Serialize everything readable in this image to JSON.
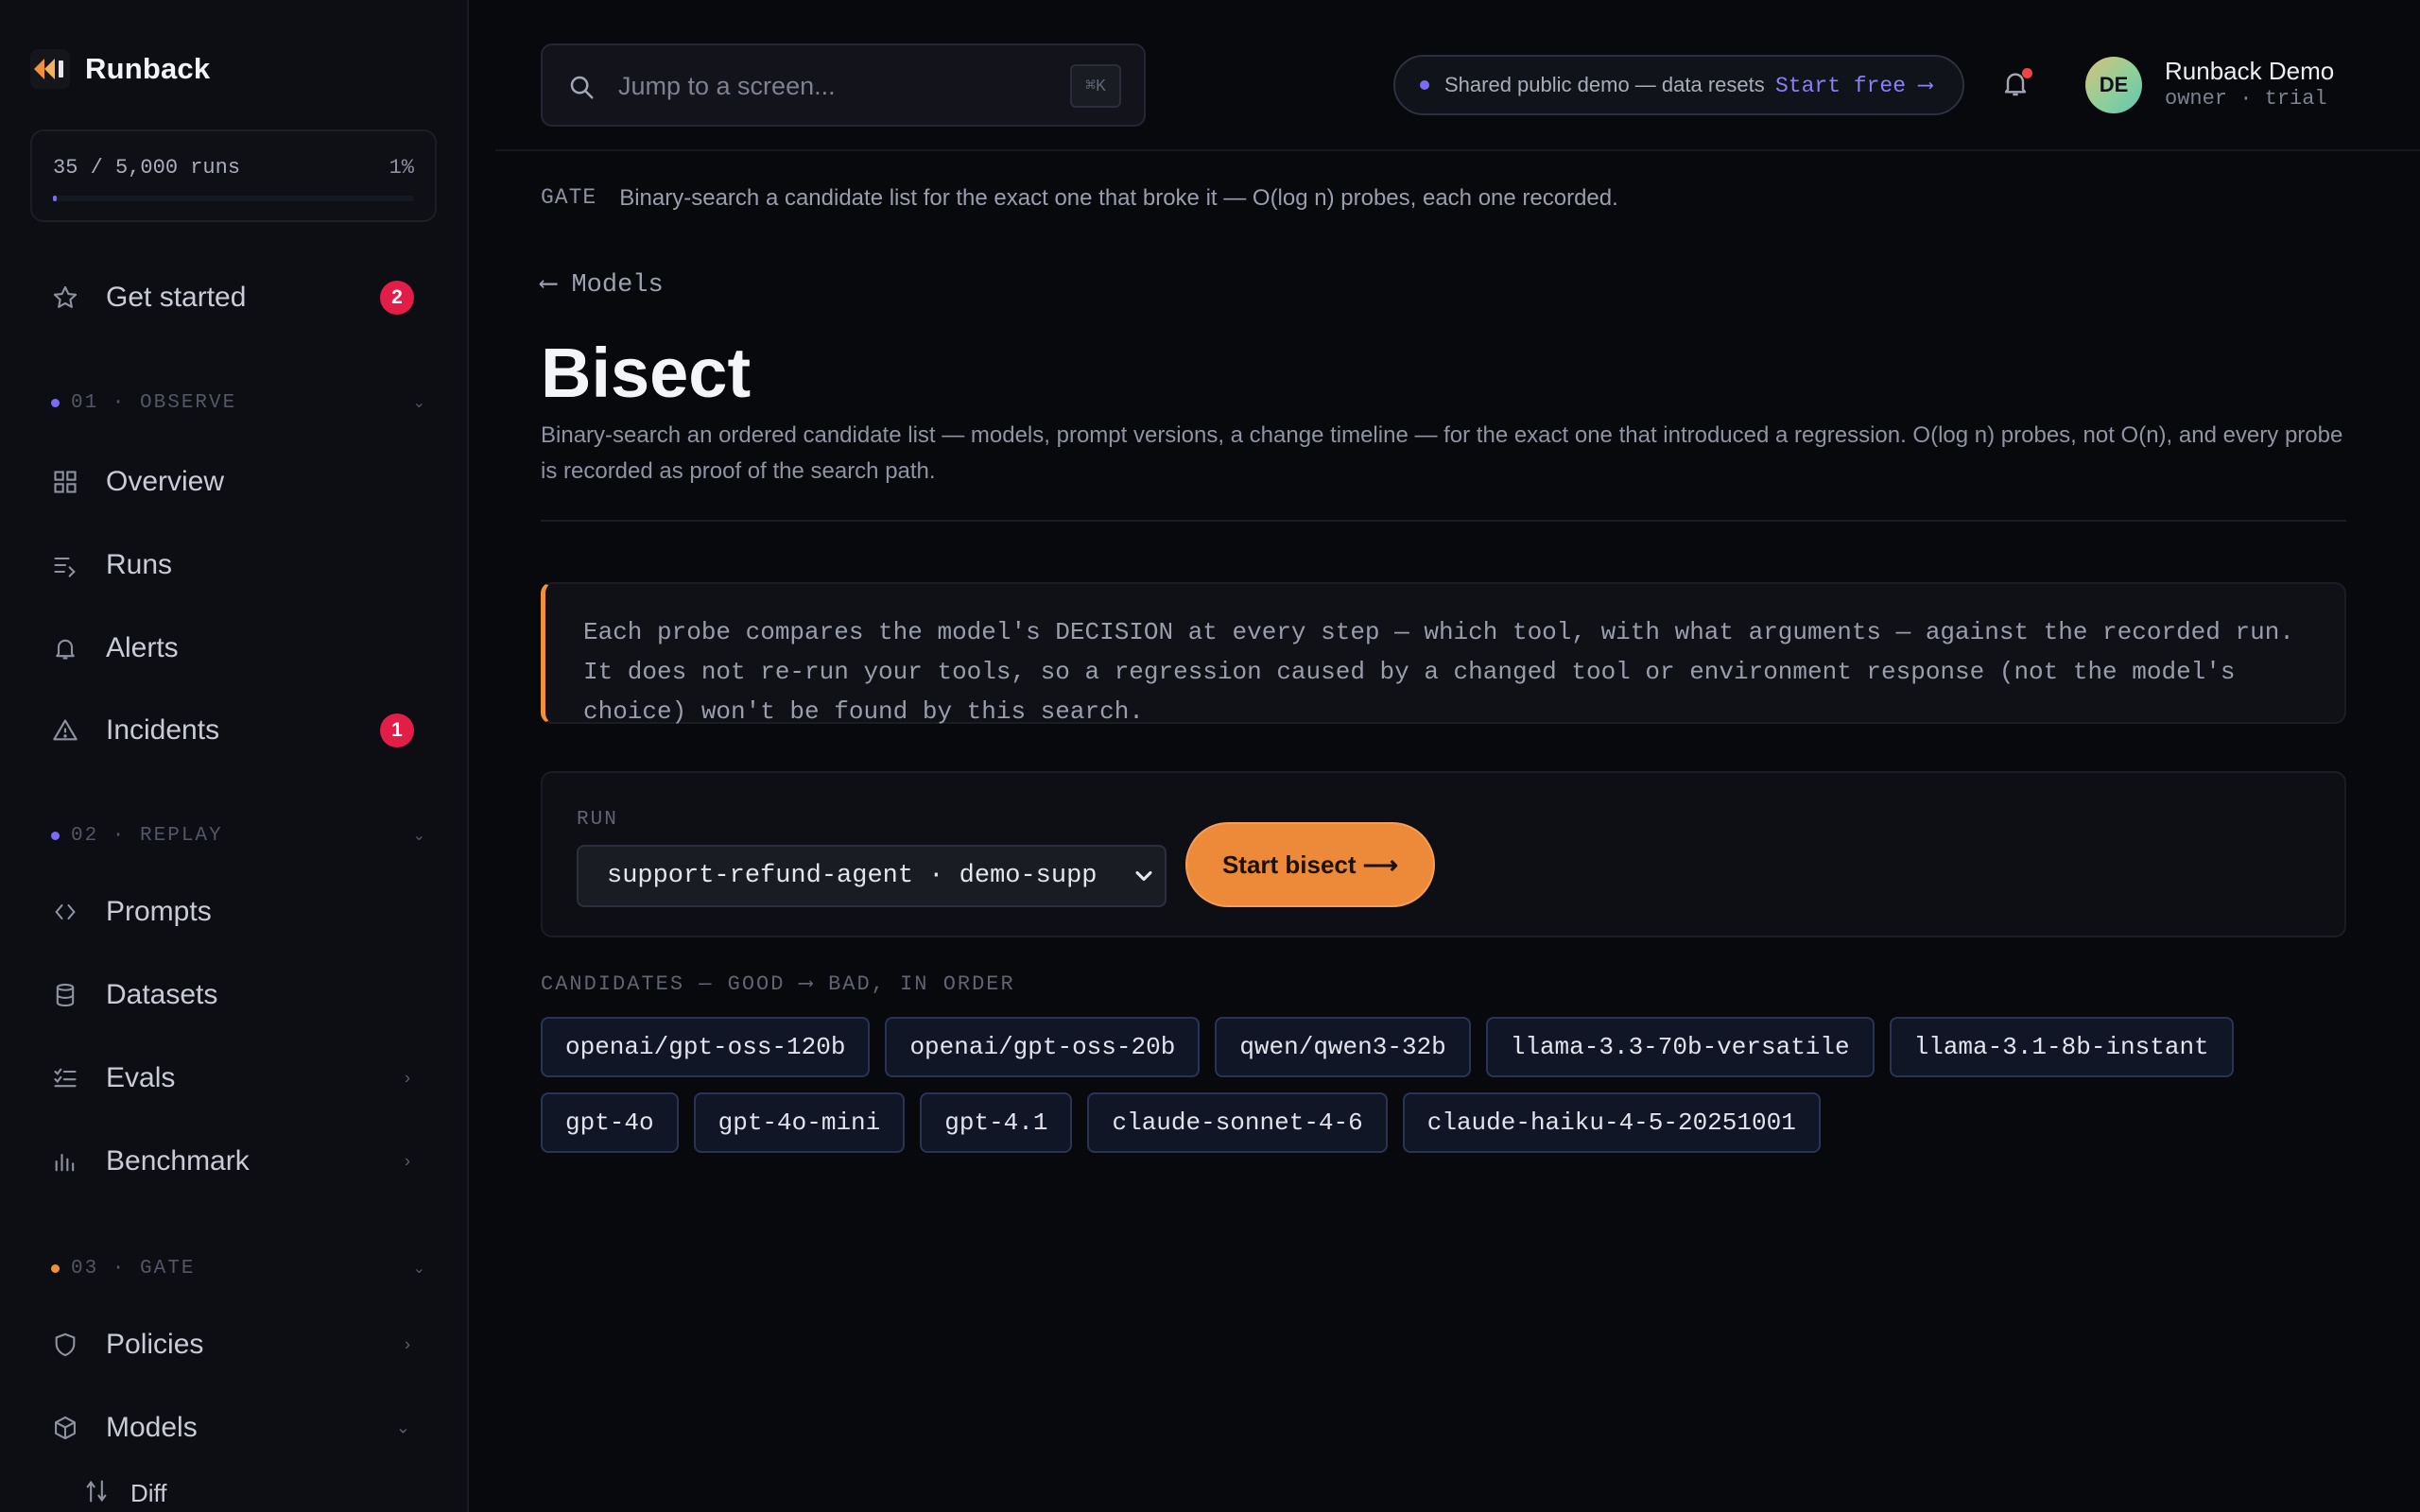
{
  "brand": {
    "name": "Runback"
  },
  "usage": {
    "text": "35 / 5,000 runs",
    "percent_label": "1%",
    "fraction": 0.007
  },
  "nav": {
    "get_started": {
      "label": "Get started",
      "badge": "2"
    },
    "section_observe": {
      "label": "01 · OBSERVE",
      "dot_color": "#7b6cf6"
    },
    "overview": {
      "label": "Overview"
    },
    "runs": {
      "label": "Runs"
    },
    "alerts": {
      "label": "Alerts"
    },
    "incidents": {
      "label": "Incidents",
      "badge": "1"
    },
    "section_replay": {
      "label": "02 · REPLAY",
      "dot_color": "#7b6cf6"
    },
    "prompts": {
      "label": "Prompts"
    },
    "datasets": {
      "label": "Datasets"
    },
    "evals": {
      "label": "Evals"
    },
    "benchmark": {
      "label": "Benchmark"
    },
    "section_gate": {
      "label": "03 · GATE",
      "dot_color": "#f0913a"
    },
    "policies": {
      "label": "Policies"
    },
    "models": {
      "label": "Models"
    },
    "diff": {
      "label": "Diff"
    }
  },
  "search": {
    "placeholder": "Jump to a screen...",
    "shortcut": "⌘K"
  },
  "demo_banner": {
    "text": "Shared public demo — data resets",
    "link": "Start free ⟶"
  },
  "user": {
    "initials": "DE",
    "name": "Runback Demo",
    "role": "owner · trial"
  },
  "gate": {
    "tag": "GATE",
    "text": "Binary-search a candidate list for the exact one that broke it — O(log n) probes, each one recorded."
  },
  "back_link": "⟵ Models",
  "page": {
    "title": "Bisect",
    "description": "Binary-search an ordered candidate list — models, prompt versions, a change timeline — for the exact one that introduced a regression. O(log n) probes, not O(n), and every probe is recorded as proof of the search path."
  },
  "callout": "Each probe compares the model's DECISION at every step — which tool, with what arguments — against the recorded run. It does not re-run your tools, so a regression caused by a changed tool or environment response (not the model's choice) won't be found by this search.",
  "run": {
    "label": "RUN",
    "selected": "support-refund-agent · demo-suppo",
    "button": "Start bisect ⟶"
  },
  "candidates": {
    "title": "CANDIDATES — GOOD ⟶ BAD, IN ORDER",
    "items": [
      "openai/gpt-oss-120b",
      "openai/gpt-oss-20b",
      "qwen/qwen3-32b",
      "llama-3.3-70b-versatile",
      "llama-3.1-8b-instant",
      "gpt-4o",
      "gpt-4o-mini",
      "gpt-4.1",
      "claude-sonnet-4-6",
      "claude-haiku-4-5-20251001"
    ]
  },
  "colors": {
    "accent": "#7b6cf6",
    "primary_button": "#ed8a3a",
    "badge": "#e11d48",
    "callout_border": "#f0913a"
  }
}
